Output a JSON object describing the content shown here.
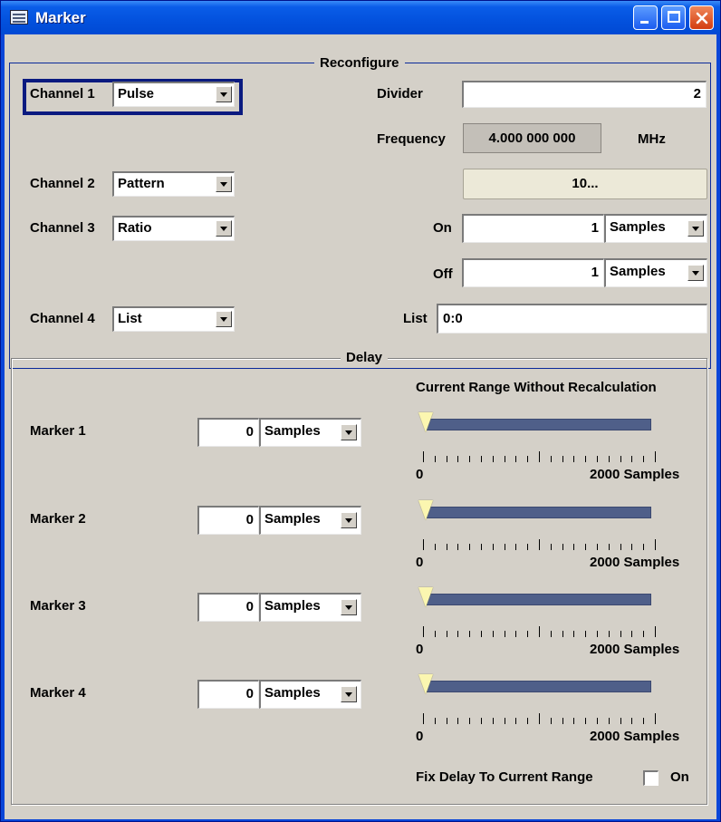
{
  "window": {
    "title": "Marker"
  },
  "reconfigure": {
    "legend": "Reconfigure",
    "channels": [
      {
        "label": "Channel 1",
        "value": "Pulse"
      },
      {
        "label": "Channel 2",
        "value": "Pattern"
      },
      {
        "label": "Channel 3",
        "value": "Ratio"
      },
      {
        "label": "Channel 4",
        "value": "List"
      }
    ],
    "divider": {
      "label": "Divider",
      "value": "2"
    },
    "frequency": {
      "label": "Frequency",
      "value": "4.000 000 000",
      "unit": "MHz"
    },
    "pattern_button": "10...",
    "on": {
      "label": "On",
      "value": "1",
      "unit": "Samples"
    },
    "off": {
      "label": "Off",
      "value": "1",
      "unit": "Samples"
    },
    "list": {
      "label": "List",
      "value": "0:0"
    }
  },
  "delay": {
    "legend": "Delay",
    "range_header": "Current Range Without Recalculation",
    "markers": [
      {
        "label": "Marker 1",
        "value": "0",
        "unit": "Samples",
        "range_min": "0",
        "range_max": "2000 Samples",
        "pointer_fraction": 0
      },
      {
        "label": "Marker 2",
        "value": "0",
        "unit": "Samples",
        "range_min": "0",
        "range_max": "2000 Samples",
        "pointer_fraction": 0
      },
      {
        "label": "Marker 3",
        "value": "0",
        "unit": "Samples",
        "range_min": "0",
        "range_max": "2000 Samples",
        "pointer_fraction": 0
      },
      {
        "label": "Marker 4",
        "value": "0",
        "unit": "Samples",
        "range_min": "0",
        "range_max": "2000 Samples",
        "pointer_fraction": 0
      }
    ],
    "fix_delay": {
      "label": "Fix Delay To Current Range",
      "checkbox_label": "On",
      "checked": false
    }
  },
  "icons": {
    "app": "window-app-icon",
    "minimize": "minimize-icon",
    "maximize": "maximize-icon",
    "close": "close-icon"
  },
  "colors": {
    "titlebar": "#0a5de8",
    "panel": "#d4d0c8",
    "range_bar": "#4f5f89",
    "pointer": "#fbf6b0",
    "focus_border": "#0a1a80"
  }
}
